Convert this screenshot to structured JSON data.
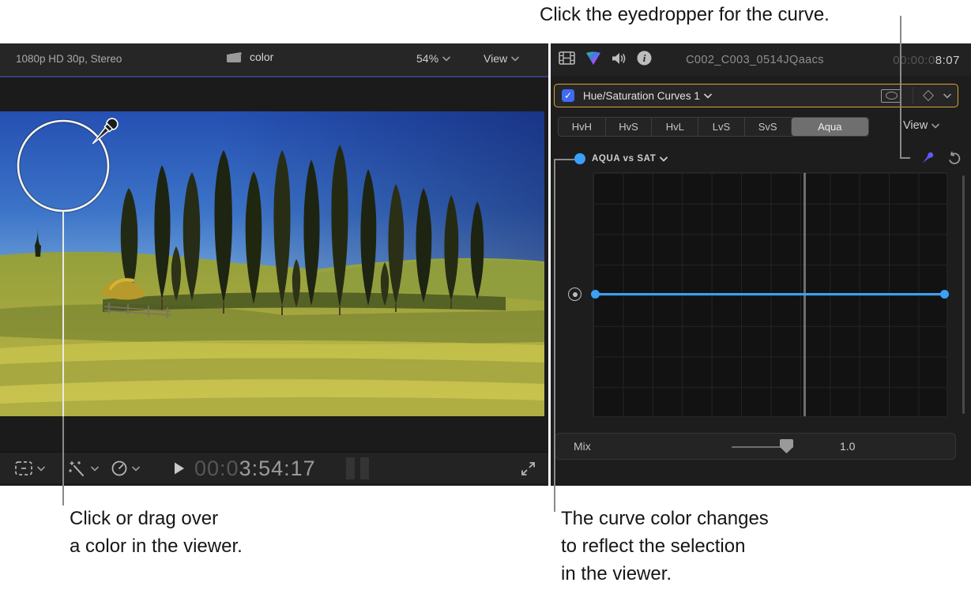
{
  "callouts": {
    "top": "Click the eyedropper for the curve.",
    "bottom_left": [
      "Click or drag over",
      "a color in the viewer."
    ],
    "bottom_right": [
      "The curve color changes",
      "to reflect the selection",
      "in the viewer."
    ]
  },
  "viewer": {
    "header": {
      "format": "1080p HD 30p, Stereo",
      "clip_name": "color",
      "zoom_level": "54%",
      "view_menu": "View"
    },
    "toolbar": {
      "timecode_dim": "00:0",
      "timecode_bright": "3:54:17"
    }
  },
  "inspector": {
    "header": {
      "title": "C002_C003_0514JQaacs",
      "timecode_dim": "00:00:0",
      "timecode_bright": "8:07"
    },
    "correction": {
      "label": "Hue/Saturation Curves 1",
      "enabled": true
    },
    "tabs": [
      "HvH",
      "HvS",
      "HvL",
      "LvS",
      "SvS",
      "Aqua"
    ],
    "selected_tab": "Aqua",
    "view_menu": "View",
    "curve": {
      "label": "AQUA vs SAT",
      "color": "#3AA0F8",
      "points": [
        {
          "x": 0.0,
          "y": 0.5
        },
        {
          "x": 1.0,
          "y": 0.5
        }
      ]
    },
    "mix": {
      "label": "Mix",
      "value": "1.0"
    }
  },
  "colors": {
    "selection_border": "#D9A72E",
    "curve_blue": "#3AA0F8",
    "checkbox_blue": "#3E6BF2",
    "eyedropper_active": "#5C5CF5",
    "selected_tab_bg": "#6F6F6F"
  }
}
